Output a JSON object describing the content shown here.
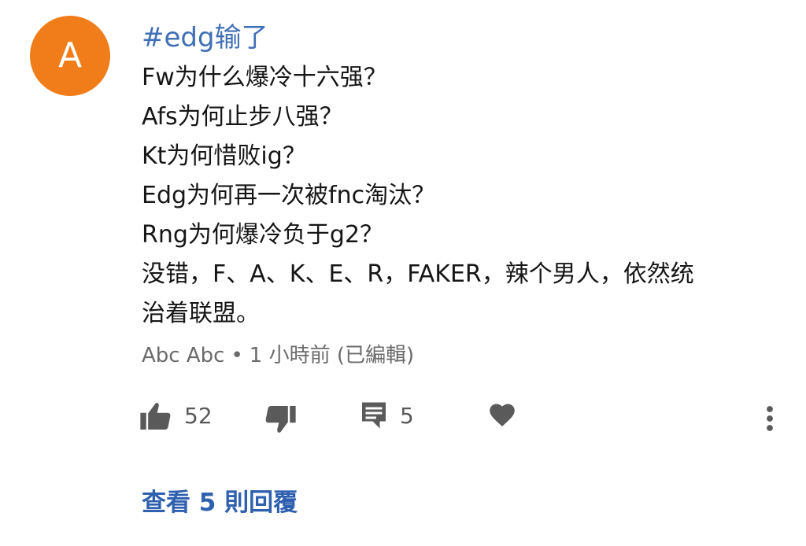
{
  "avatar": {
    "letter": "A",
    "color": "#f07c1a"
  },
  "comment": {
    "hashtag": "#edg输了",
    "lines": [
      "Fw为什么爆冷十六强？",
      "Afs为何止步八强？",
      "Kt为何惜败ig？",
      "Edg为何再一次被fnc淘汰？",
      "Rng为何爆冷负于g2？",
      "没错，F、A、K、E、R，FAKER，辣个男人，依然统",
      "治着联盟。"
    ]
  },
  "meta": {
    "author": "Abc Abc",
    "separator": "•",
    "time": "1 小時前 (已編輯)"
  },
  "actions": {
    "like_count": "52",
    "reply_count": "5",
    "icons": [
      "thumbs-up-icon",
      "thumbs-down-icon",
      "comment-icon",
      "heart-icon",
      "more-vert-icon"
    ]
  },
  "replies": {
    "label": "查看 5 則回覆"
  },
  "colors": {
    "link": "#2f60b0",
    "hashtag": "#3f6fb6",
    "icon": "#5a5a5a",
    "meta": "#6b6b6b"
  }
}
